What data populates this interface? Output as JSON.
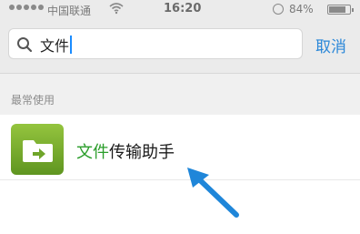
{
  "status_bar": {
    "carrier": "中国联通",
    "time": "16:20",
    "battery_percent": "84%",
    "battery_level": 0.84
  },
  "search": {
    "query": "文件",
    "cancel_label": "取消"
  },
  "section": {
    "title": "最常使用"
  },
  "results": [
    {
      "match": "文件",
      "rest": "传输助手",
      "icon": "folder-arrow-icon"
    }
  ],
  "colors": {
    "highlight": "#2a9d2a",
    "cancel": "#2a87d8",
    "icon_green": "#7cb330",
    "arrow_blue": "#1f86d9"
  }
}
